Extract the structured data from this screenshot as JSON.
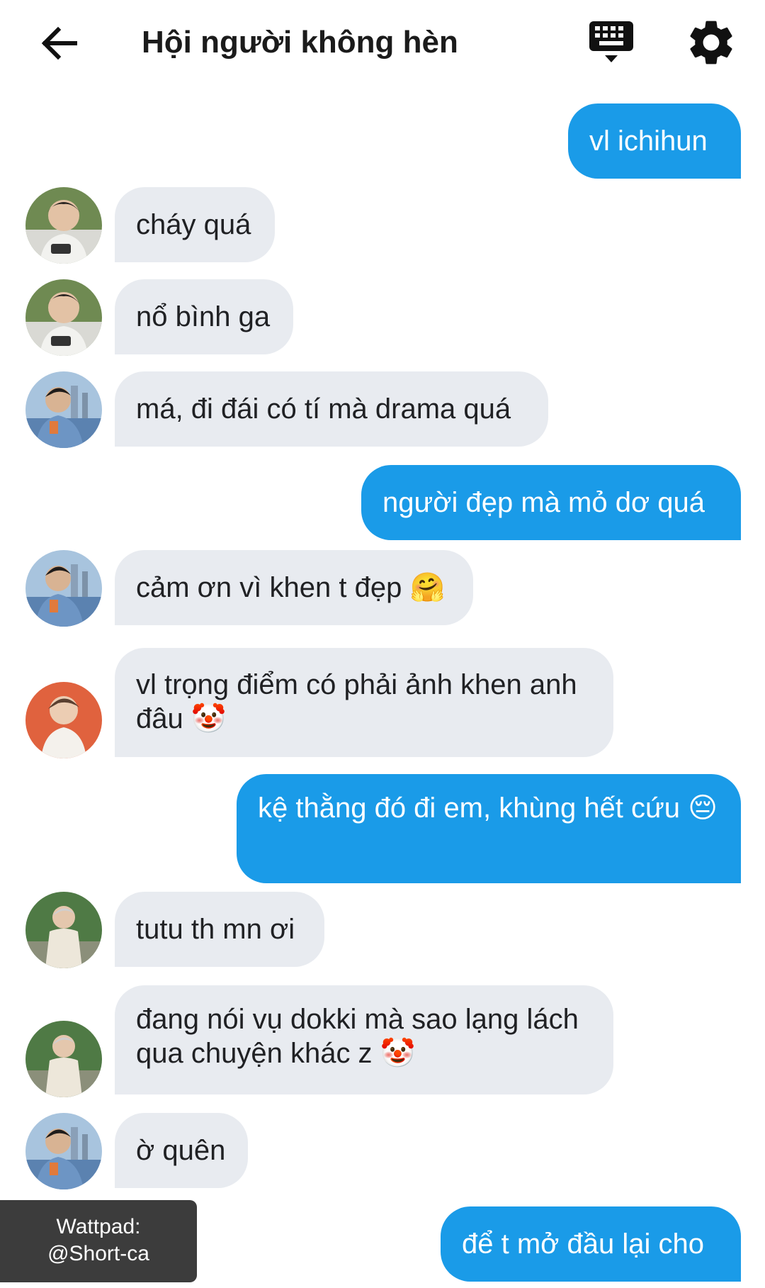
{
  "header": {
    "title": "Hội người không hèn",
    "back_icon": "arrow-left-icon",
    "keyboard_icon": "keyboard-icon",
    "settings_icon": "gear-icon"
  },
  "colors": {
    "outgoing": "#1a9be8",
    "incoming": "#e8ebf0"
  },
  "messages": [
    {
      "dir": "out",
      "text": "vl ichihun"
    },
    {
      "dir": "in",
      "sender": "avatar-a",
      "text": "cháy quá"
    },
    {
      "dir": "in",
      "sender": "avatar-a",
      "text": "nổ bình ga"
    },
    {
      "dir": "in",
      "sender": "avatar-b",
      "text": "má, đi đái có tí mà drama quá"
    },
    {
      "dir": "out",
      "text": "người đẹp mà mỏ dơ quá"
    },
    {
      "dir": "in",
      "sender": "avatar-b",
      "text": "cảm ơn vì khen t đẹp",
      "emoji": "🤗"
    },
    {
      "dir": "in",
      "sender": "avatar-c",
      "text": "vl trọng điểm có phải ảnh khen anh đâu",
      "emoji": "🤡"
    },
    {
      "dir": "out",
      "text": "kệ thằng đó đi em, khùng hết cứu",
      "emoji": "😔"
    },
    {
      "dir": "in",
      "sender": "avatar-d",
      "text": "tutu th mn ơi"
    },
    {
      "dir": "in",
      "sender": "avatar-d",
      "text": "đang nói vụ dokki mà sao lạng lách qua chuyện khác z",
      "emoji": "🤡"
    },
    {
      "dir": "in",
      "sender": "avatar-b",
      "text": "ờ quên"
    },
    {
      "dir": "out",
      "text": "để t mở đầu lại cho"
    }
  ],
  "watermark": {
    "line1": "Wattpad:",
    "line2": "@Short-ca"
  }
}
